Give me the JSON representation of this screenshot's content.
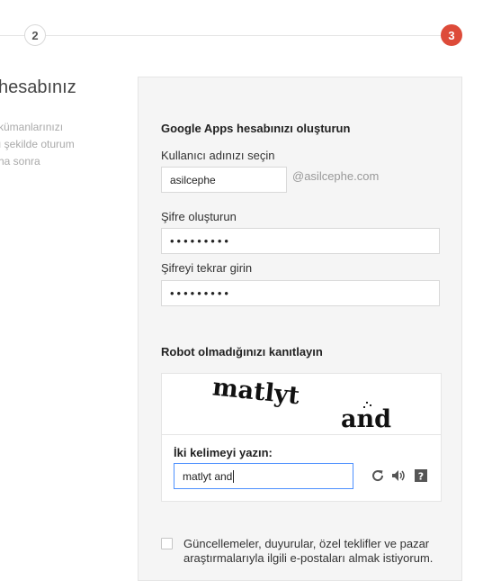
{
  "stepper": {
    "step2": "2",
    "step3": "3"
  },
  "left": {
    "title": "hesabınız",
    "desc": "kümanlarınızı\nı şekilde oturum\nha sonra"
  },
  "form": {
    "heading": "Google Apps hesabınızı oluşturun",
    "username_label": "Kullanıcı adınızı seçin",
    "username_value": "asilcephe",
    "domain_suffix": "@asilcephe.com",
    "password_label": "Şifre oluşturun",
    "password_value": "•••••••••",
    "confirm_label": "Şifreyi tekrar girin",
    "confirm_value": "•••••••••"
  },
  "captcha": {
    "heading": "Robot olmadığınızı kanıtlayın",
    "word1": "matlyt",
    "word2": "and",
    "prompt": "İki kelimeyi yazın:",
    "input_value": "matlyt and",
    "help_glyph": "?"
  },
  "newsletter": {
    "label": "Güncellemeler, duyurular, özel teklifler ve pazar araştırmalarıyla ilgili e-postaları almak istiyorum."
  }
}
